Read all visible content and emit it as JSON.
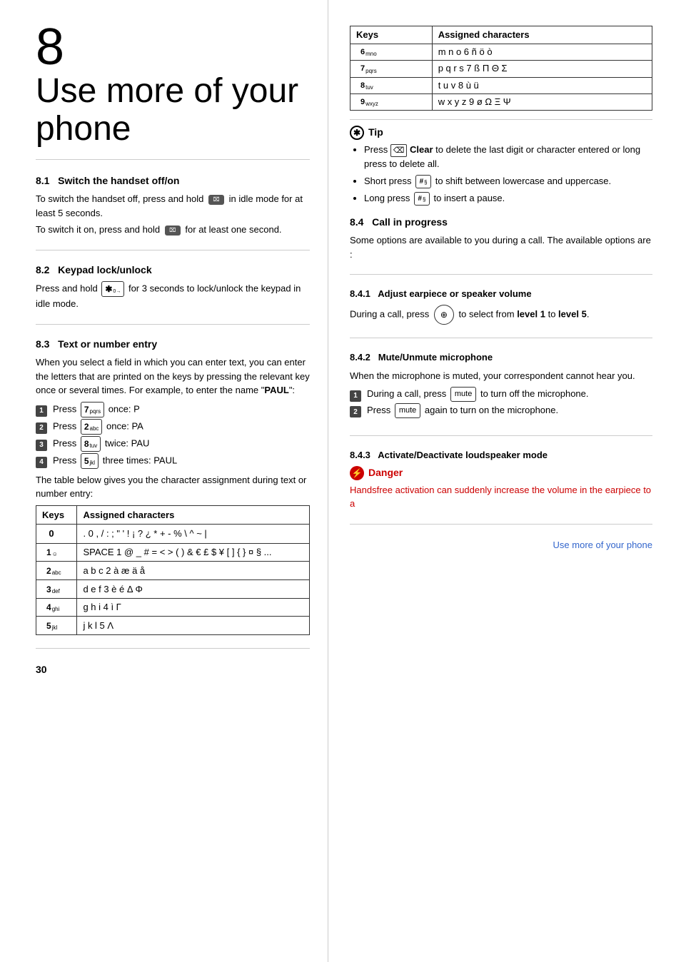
{
  "chapter": {
    "number": "8",
    "title_line1": "Use more of your",
    "title_line2": "phone"
  },
  "sections": {
    "s8_1": {
      "number": "8.1",
      "title": "Switch the handset off/on",
      "body_1": "To switch the handset off, press and hold",
      "body_2": "in idle mode for at least 5 seconds.",
      "body_3": "To switch it on, press and hold",
      "body_4": "for at least one second."
    },
    "s8_2": {
      "number": "8.2",
      "title": "Keypad lock/unlock",
      "body": "Press and hold",
      "body2": "for 3 seconds to lock/unlock the keypad in idle mode."
    },
    "s8_3": {
      "number": "8.3",
      "title": "Text or number entry",
      "body_1": "When you select a field in which you can enter text, you can enter the letters that are printed on the keys by pressing the relevant key once or several times. For example, to enter the name \"",
      "body_1_bold": "PAUL",
      "body_1_end": "\":",
      "steps": [
        {
          "num": "1",
          "text": "Press ",
          "key": "7",
          "key_sub": "pqrs",
          "after": " once: P"
        },
        {
          "num": "2",
          "text": "Press ",
          "key": "2",
          "key_sub": "abc",
          "after": " once: PA"
        },
        {
          "num": "3",
          "text": "Press ",
          "key": "8",
          "key_sub": "tuv",
          "after": " twice: PAU"
        },
        {
          "num": "4",
          "text": "Press ",
          "key": "5",
          "key_sub": "jkl",
          "after": " three times: PAUL"
        }
      ],
      "table_intro": "The table below gives you the character assignment during text or number entry:",
      "table": {
        "headers": [
          "Keys",
          "Assigned characters"
        ],
        "rows": [
          {
            "key": "0",
            "key_sub": "",
            "chars": ". 0 , / : ;  \" ' ! ¡ ? ¿ * + - % \\ ^  ~ |"
          },
          {
            "key": "1",
            "key_sub": "☺",
            "chars": "SPACE 1 @ _ # = < > ( ) &  € £ $ ¥ [ ] { } ¤ § ..."
          },
          {
            "key": "2",
            "key_sub": "abc",
            "chars": "a b c 2 à æ ä å"
          },
          {
            "key": "3",
            "key_sub": "def",
            "chars": "d e f 3 è é Δ Φ"
          },
          {
            "key": "4",
            "key_sub": "ghi",
            "chars": "g h i 4 ì Γ"
          },
          {
            "key": "5",
            "key_sub": "jkl",
            "chars": "j k l 5 Λ"
          }
        ]
      }
    },
    "tip": {
      "header": "Tip",
      "items": [
        "Press  Clear to delete the last digit or character entered or long press to delete all.",
        "Short press  to shift between lowercase and uppercase.",
        "Long press  to insert a pause."
      ]
    },
    "right_table": {
      "headers": [
        "Keys",
        "Assigned characters"
      ],
      "rows": [
        {
          "key": "6",
          "key_sub": "mno",
          "chars": "m n o 6 ñ ö ò"
        },
        {
          "key": "7",
          "key_sub": "pqrs",
          "chars": "p q r s 7 ß Π Θ Σ"
        },
        {
          "key": "8",
          "key_sub": "tuv",
          "chars": "t u v 8 ù ü"
        },
        {
          "key": "9",
          "key_sub": "wxyz",
          "chars": "w x y z 9 ø Ω Ξ Ψ"
        }
      ]
    },
    "s8_4": {
      "number": "8.4",
      "title": "Call in progress",
      "body": "Some options are available to you during a call. The available options are :"
    },
    "s8_4_1": {
      "number": "8.4.1",
      "title": "Adjust earpiece or speaker volume",
      "body_1": "During a call, press",
      "body_2": "to select from",
      "bold_1": "level 1",
      "body_3": "to",
      "bold_2": "level 5",
      "body_4": "."
    },
    "s8_4_2": {
      "number": "8.4.2",
      "title": "Mute/Unmute microphone",
      "body": "When the microphone is muted, your correspondent cannot hear you.",
      "steps": [
        {
          "num": "1",
          "text": "During a call, press ",
          "key": "mute",
          "after": " to turn off the microphone."
        },
        {
          "num": "2",
          "text": "Press ",
          "key": "mute",
          "after": " again to turn on the microphone."
        }
      ]
    },
    "s8_4_3": {
      "number": "8.4.3",
      "title": "Activate/Deactivate loudspeaker mode",
      "danger_header": "Danger",
      "danger_text": "Handsfree activation can suddenly increase the volume in the earpiece to a"
    }
  },
  "footer": {
    "page_number": "30",
    "footer_text": "Use more of your phone"
  }
}
